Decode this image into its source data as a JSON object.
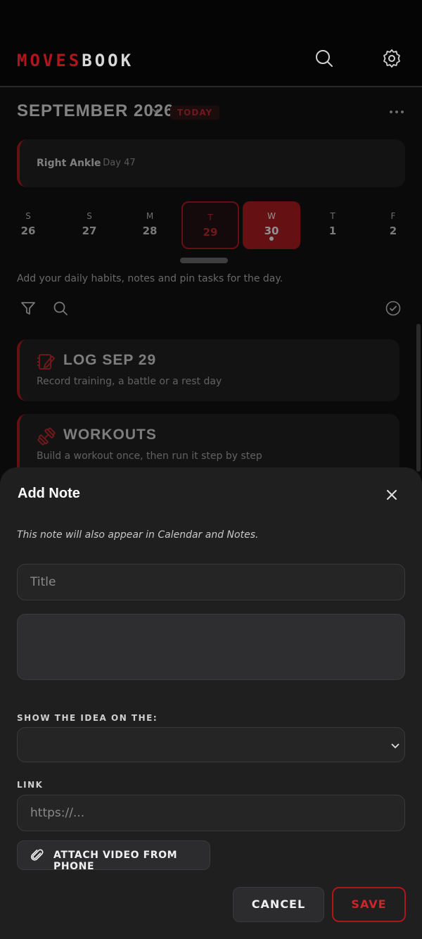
{
  "header": {
    "logo_part1": "MOVES",
    "logo_part2": "BOOK",
    "search_icon": "search-icon",
    "settings_icon": "gear-icon"
  },
  "calendar": {
    "month_title": "SEPTEMBER 2026",
    "today_badge": "TODAY",
    "injury": {
      "name": "Right Ankle",
      "day_text": "· Day 47"
    },
    "days": [
      {
        "letter": "S",
        "num": "26",
        "state": "normal"
      },
      {
        "letter": "S",
        "num": "27",
        "state": "normal"
      },
      {
        "letter": "M",
        "num": "28",
        "state": "normal"
      },
      {
        "letter": "T",
        "num": "29",
        "state": "selected"
      },
      {
        "letter": "W",
        "num": "30",
        "state": "today"
      },
      {
        "letter": "T",
        "num": "1",
        "state": "normal"
      },
      {
        "letter": "F",
        "num": "2",
        "state": "normal"
      }
    ],
    "hint": "Add your daily habits, notes and pin tasks for the day."
  },
  "cards": [
    {
      "title": "LOG SEP 29",
      "subtitle": "Record training, a battle or a rest day",
      "icon": "notebook-edit-icon"
    },
    {
      "title": "WORKOUTS",
      "subtitle": "Build a workout once, then run it step by step",
      "icon": "dumbbell-icon"
    }
  ],
  "modal": {
    "title": "Add Note",
    "note": "This note will also appear in Calendar and Notes.",
    "title_placeholder": "Title",
    "body_value": "",
    "show_label": "SHOW THE IDEA ON THE:",
    "show_selected": "",
    "link_label": "LINK",
    "link_placeholder": "https://...",
    "attach_label": "ATTACH VIDEO FROM PHONE",
    "cancel_label": "CANCEL",
    "save_label": "SAVE"
  },
  "colors": {
    "accent": "#b0151c",
    "background": "#0a0a0a",
    "sheet": "#1f1f20"
  }
}
